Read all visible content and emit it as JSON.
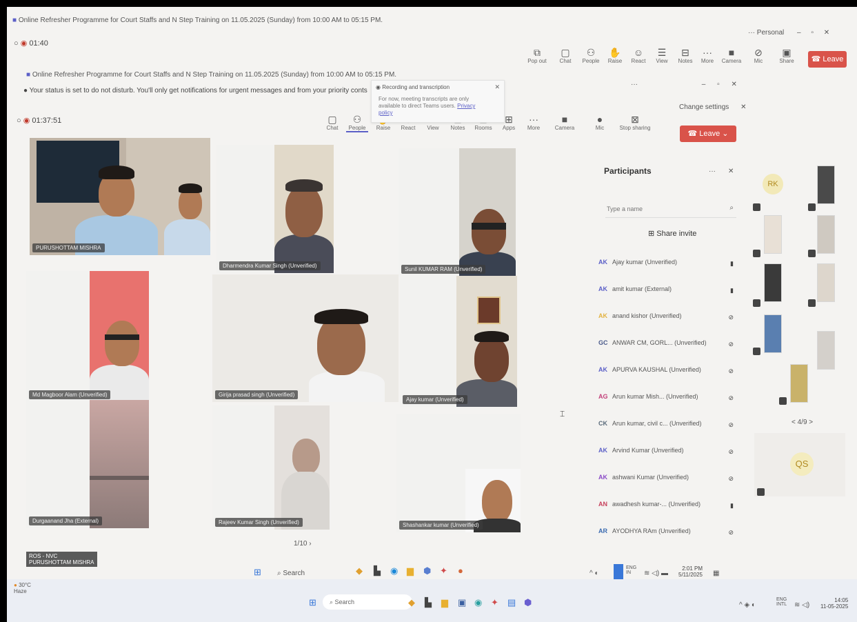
{
  "outer": {
    "title": "Online Refresher Programme for Court Staffs and N Step Training on 11.05.2025 (Sunday) from 10:00 AM to 05:15 PM.",
    "timer": "01:40",
    "personal_label": "Personal",
    "toolbar": [
      "Pop out",
      "Chat",
      "People",
      "Raise",
      "React",
      "View",
      "Notes",
      "Apps",
      "More",
      "Camera",
      "Mic",
      "Share"
    ],
    "leave_label": "Leave"
  },
  "inner": {
    "title": "Online Refresher Programme for Court Staffs and N Step Training on 11.05.2025 (Sunday) from 10:00 AM to 05:15 PM.",
    "dnd_notice": "Your status is set to do not disturb. You'll only get notifications for urgent messages and from your priority conts",
    "change_settings": "Change settings",
    "timer": "01:37:51",
    "toolbar": [
      "Chat",
      "People",
      "Raise",
      "React",
      "View",
      "Notes",
      "Rooms",
      "Apps",
      "More",
      "Camera",
      "Mic",
      "Stop sharing"
    ],
    "leave_label": "Leave"
  },
  "recording_popup": {
    "title": "Recording and transcription",
    "body": "For now, meeting transcripts are only available to direct Teams users.",
    "link": "Privacy policy"
  },
  "tiles": [
    {
      "name": "PURUSHOTTAM MISHRA"
    },
    {
      "name": "Dharmendra Kumar Singh (Unverified)"
    },
    {
      "name": "Sunil KUMAR RAM (Unverified)"
    },
    {
      "name": "Md Magboor Alam (Unverified)"
    },
    {
      "name": "Girija prasad singh (Unverified)"
    },
    {
      "name": "Ajay kumar (Unverified)"
    },
    {
      "name": "Durgaanand Jha (External)"
    },
    {
      "name": "Rajeev Kumar Singh (Unverified)"
    },
    {
      "name": "Shashankar kumar (Unverified)"
    }
  ],
  "gallery_page": "1/10",
  "participants": {
    "title": "Participants",
    "search_placeholder": "Type a name",
    "share_invite": "Share invite",
    "list": [
      {
        "initials": "AK",
        "name": "Ajay kumar (Unverified)",
        "color": "#5b5fc7"
      },
      {
        "initials": "AK",
        "name": "amit kumar (External)",
        "color": "#5b5fc7"
      },
      {
        "initials": "AK",
        "name": "anand kishor (Unverified)",
        "color": "#e3b341"
      },
      {
        "initials": "GC",
        "name": "ANWAR CM, GORL... (Unverified)",
        "color": "#4a5a8a"
      },
      {
        "initials": "AK",
        "name": "APURVA KAUSHAL (Unverified)",
        "color": "#5b5fc7"
      },
      {
        "initials": "AG",
        "name": "Arun kumar Mish... (Unverified)",
        "color": "#c2407a"
      },
      {
        "initials": "CK",
        "name": "Arun kumar, civil c... (Unverified)",
        "color": "#5a6a7a"
      },
      {
        "initials": "AK",
        "name": "Arvind Kumar (Unverified)",
        "color": "#5b5fc7"
      },
      {
        "initials": "AK",
        "name": "ashwani Kumar (Unverified)",
        "color": "#8a4ac7"
      },
      {
        "initials": "AN",
        "name": "awadhesh kumar-... (Unverified)",
        "color": "#c7405b"
      },
      {
        "initials": "AR",
        "name": "AYODHYA RAm (Unverified)",
        "color": "#3a6ab0"
      }
    ]
  },
  "strip": {
    "rk": "RK",
    "qs": "QS",
    "page": "< 4/9 >"
  },
  "taskbar_inner": {
    "search": "Search",
    "lang": "ENG IN",
    "time": "2:01 PM",
    "date": "5/11/2025",
    "name_chip": "PURUSHOTTAM MISHRA",
    "chip_top": "ROS - NVC"
  },
  "taskbar_outer": {
    "search": "Search",
    "weather": "Haze",
    "weather_top": "30°C",
    "lang": "ENG INTL",
    "time": "14:05",
    "date": "11-05-2025"
  },
  "colors": {
    "leave": "#d9534a",
    "accent": "#5b5fc7"
  }
}
